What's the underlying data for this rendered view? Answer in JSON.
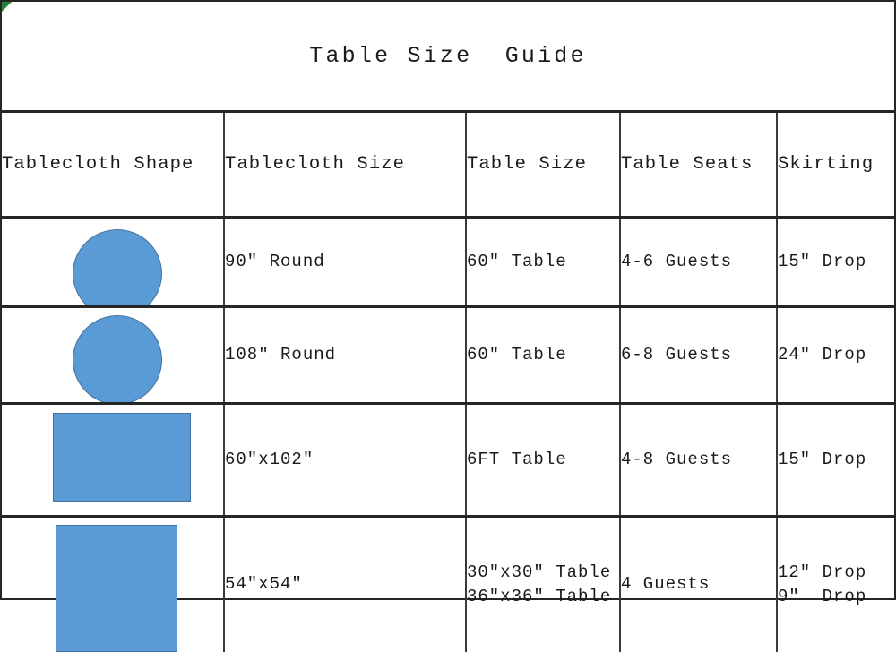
{
  "title": "Table Size  Guide",
  "colors": {
    "shape_fill": "#5B9BD5",
    "shape_stroke": "#41719C",
    "grid": "#262626",
    "text": "#1A1A1A",
    "corner_artifact": "#1F7A2E"
  },
  "table": {
    "columns": [
      {
        "key": "shape",
        "label": "Tablecloth Shape"
      },
      {
        "key": "cloth",
        "label": "Tablecloth Size"
      },
      {
        "key": "tbl",
        "label": "Table Size"
      },
      {
        "key": "seats",
        "label": "Table Seats"
      },
      {
        "key": "skirt",
        "label": "Skirting"
      }
    ],
    "rows": [
      {
        "shape_icon": "circle-shape-icon",
        "shape_kind": "circle",
        "cloth": "90″ Round",
        "tbl": "60″ Table",
        "seats": "4-6 Guests",
        "skirt": "15″ Drop"
      },
      {
        "shape_icon": "circle-shape-icon",
        "shape_kind": "circle",
        "cloth": "108″ Round",
        "tbl": "60″ Table",
        "seats": "6-8 Guests",
        "skirt": "24″ Drop"
      },
      {
        "shape_icon": "rectangle-shape-icon",
        "shape_kind": "rectangle",
        "cloth": "60″x102″",
        "tbl": "6FT Table",
        "seats": "4-8 Guests",
        "skirt": "15″ Drop"
      },
      {
        "shape_icon": "square-shape-icon",
        "shape_kind": "square",
        "cloth": "54″x54″",
        "tbl": "30″x30″ Table\n36″x36″ Table",
        "seats": "4 Guests",
        "skirt": "12″ Drop\n9″  Drop"
      }
    ]
  }
}
